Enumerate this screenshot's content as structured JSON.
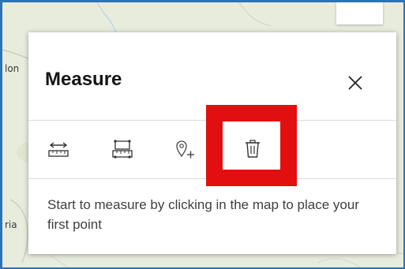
{
  "map": {
    "labels": [
      "lon",
      "ria"
    ]
  },
  "panel": {
    "title": "Measure",
    "close_icon": "close-icon",
    "tools": [
      {
        "name": "distance",
        "icon": "measure-distance-icon"
      },
      {
        "name": "area",
        "icon": "measure-area-icon"
      },
      {
        "name": "new-measurement",
        "icon": "add-point-icon"
      },
      {
        "name": "clear",
        "icon": "trash-icon"
      }
    ],
    "hint": "Start to measure by clicking in the map to place your first point"
  },
  "highlight": {
    "color": "#e10f10"
  },
  "colors": {
    "frame": "#2c73b8",
    "map_bg": "#e9ecdf"
  }
}
